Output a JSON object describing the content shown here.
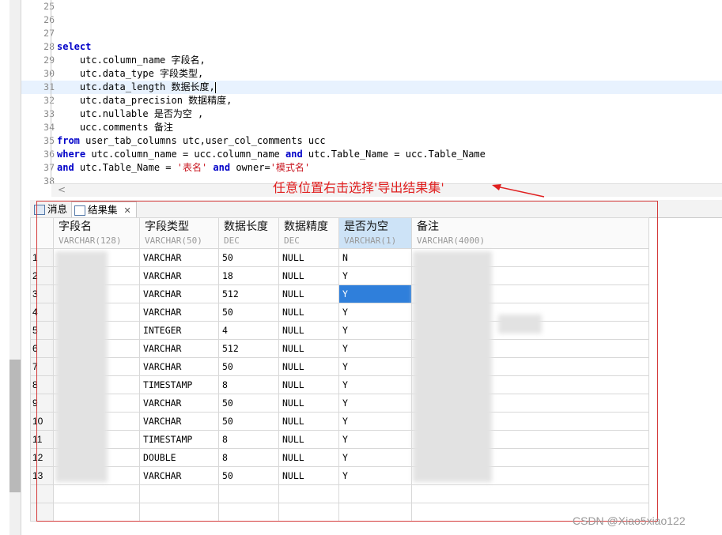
{
  "editor": {
    "lines": [
      {
        "no": "25",
        "segments": []
      },
      {
        "no": "26",
        "segments": []
      },
      {
        "no": "27",
        "segments": []
      },
      {
        "no": "28",
        "segments": [
          {
            "t": "select",
            "k": "kw"
          }
        ]
      },
      {
        "no": "29",
        "segments": [
          {
            "t": "    utc.column_name 字段名,",
            "k": ""
          }
        ]
      },
      {
        "no": "30",
        "segments": [
          {
            "t": "    utc.data_type 字段类型,",
            "k": ""
          }
        ]
      },
      {
        "no": "31",
        "segments": [
          {
            "t": "    utc.data_length 数据长度,",
            "k": ""
          }
        ],
        "highlight": true
      },
      {
        "no": "32",
        "segments": [
          {
            "t": "    utc.data_precision 数据精度,",
            "k": ""
          }
        ]
      },
      {
        "no": "33",
        "segments": [
          {
            "t": "    utc.nullable 是否为空 ,",
            "k": ""
          }
        ]
      },
      {
        "no": "34",
        "segments": [
          {
            "t": "    ucc.comments 备注",
            "k": ""
          }
        ]
      },
      {
        "no": "35",
        "segments": [
          {
            "t": "from",
            "k": "kw"
          },
          {
            "t": " user_tab_columns utc,user_col_comments ucc",
            "k": ""
          }
        ]
      },
      {
        "no": "36",
        "segments": [
          {
            "t": "where",
            "k": "kw"
          },
          {
            "t": " utc.column_name = ucc.column_name ",
            "k": ""
          },
          {
            "t": "and",
            "k": "kw"
          },
          {
            "t": " utc.Table_Name = ucc.Table_Name",
            "k": ""
          }
        ]
      },
      {
        "no": "37",
        "segments": [
          {
            "t": "and",
            "k": "kw"
          },
          {
            "t": " utc.Table_Name = ",
            "k": ""
          },
          {
            "t": "'表名'",
            "k": "str"
          },
          {
            "t": " ",
            "k": ""
          },
          {
            "t": "and",
            "k": "kw"
          },
          {
            "t": " owner=",
            "k": ""
          },
          {
            "t": "'模式名'",
            "k": "str"
          }
        ]
      },
      {
        "no": "38",
        "segments": []
      }
    ]
  },
  "annotation": "任意位置右击选择'导出结果集'",
  "tabs": [
    {
      "label": "消息",
      "icon": "message-icon"
    },
    {
      "label": "结果集",
      "icon": "table-icon",
      "close": "✕",
      "active": true
    }
  ],
  "grid": {
    "columns": [
      {
        "name": "字段名",
        "type": "VARCHAR(128)"
      },
      {
        "name": "字段类型",
        "type": "VARCHAR(50)"
      },
      {
        "name": "数据长度",
        "type": "DEC"
      },
      {
        "name": "数据精度",
        "type": "DEC"
      },
      {
        "name": "是否为空",
        "type": "VARCHAR(1)",
        "selected": true
      },
      {
        "name": "备注",
        "type": "VARCHAR(4000)"
      }
    ],
    "rows": [
      [
        "1",
        "",
        "VARCHAR",
        "50",
        "NULL",
        "N",
        ""
      ],
      [
        "2",
        "",
        "VARCHAR",
        "18",
        "NULL",
        "Y",
        ""
      ],
      [
        "3",
        "",
        "VARCHAR",
        "512",
        "NULL",
        "Y",
        ""
      ],
      [
        "4",
        "",
        "VARCHAR",
        "50",
        "NULL",
        "Y",
        ""
      ],
      [
        "5",
        "",
        "INTEGER",
        "4",
        "NULL",
        "Y",
        ""
      ],
      [
        "6",
        "",
        "VARCHAR",
        "512",
        "NULL",
        "Y",
        ""
      ],
      [
        "7",
        "",
        "VARCHAR",
        "50",
        "NULL",
        "Y",
        ""
      ],
      [
        "8",
        "",
        "TIMESTAMP",
        "8",
        "NULL",
        "Y",
        ""
      ],
      [
        "9",
        "",
        "VARCHAR",
        "50",
        "NULL",
        "Y",
        ""
      ],
      [
        "10",
        "",
        "VARCHAR",
        "50",
        "NULL",
        "Y",
        ""
      ],
      [
        "11",
        "",
        "TIMESTAMP",
        "8",
        "NULL",
        "Y",
        ""
      ],
      [
        "12",
        "",
        "DOUBLE",
        "8",
        "NULL",
        "Y",
        ""
      ],
      [
        "13",
        "",
        "VARCHAR",
        "50",
        "NULL",
        "Y",
        ""
      ]
    ],
    "selected_row": 2
  },
  "watermark": "CSDN @Xiao5xiao122",
  "colors": {
    "keyword": "#0000c8",
    "string": "#c8141e",
    "annotation": "#e02020",
    "selection": "#2f7fdb"
  }
}
